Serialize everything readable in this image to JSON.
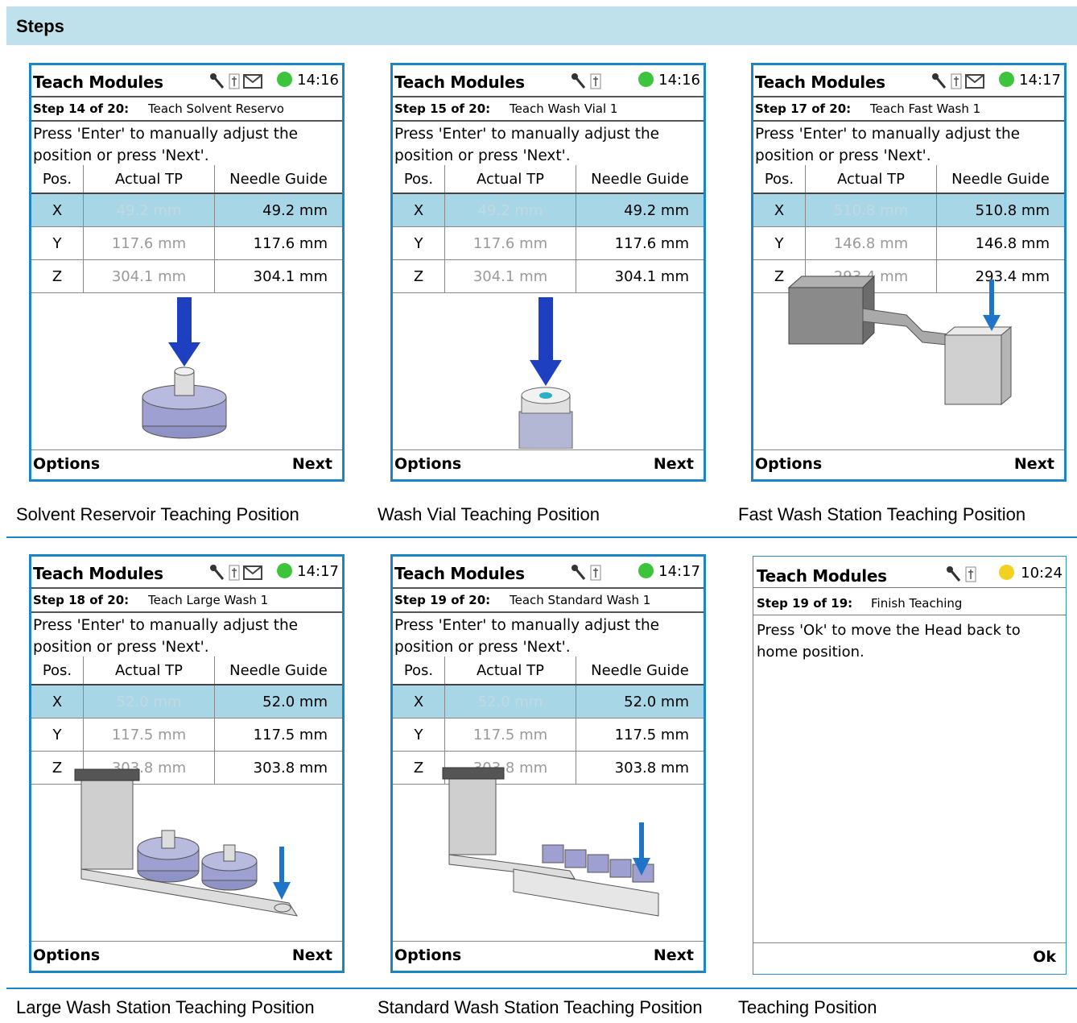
{
  "header": {
    "title": "Steps"
  },
  "panels": [
    {
      "title": "Teach Modules",
      "time": "14:16",
      "step_bold": "Step 14 of 20:",
      "step_name": "Teach Solvent Reservo",
      "instruction": "Press 'Enter' to manually adjust the position or press 'Next'.",
      "columns": [
        "Pos.",
        "Actual TP",
        "Needle Guide"
      ],
      "rows": [
        [
          "X",
          "49.2 mm",
          "49.2 mm"
        ],
        [
          "Y",
          "117.6 mm",
          "117.6 mm"
        ],
        [
          "Z",
          "304.1 mm",
          "304.1 mm"
        ]
      ],
      "left_key": "Options",
      "right_key": "Next",
      "caption": "Solvent Reservoir Teaching Position"
    },
    {
      "title": "Teach Modules",
      "time": "14:16",
      "step_bold": "Step 15 of 20:",
      "step_name": "Teach Wash Vial 1",
      "instruction": "Press 'Enter' to manually adjust the position or press 'Next'.",
      "columns": [
        "Pos.",
        "Actual TP",
        "Needle Guide"
      ],
      "rows": [
        [
          "X",
          "49.2 mm",
          "49.2 mm"
        ],
        [
          "Y",
          "117.6 mm",
          "117.6 mm"
        ],
        [
          "Z",
          "304.1 mm",
          "304.1 mm"
        ]
      ],
      "left_key": "Options",
      "right_key": "Next",
      "caption": "Wash Vial Teaching Position"
    },
    {
      "title": "Teach Modules",
      "time": "14:17",
      "step_bold": "Step 17 of 20:",
      "step_name": "Teach Fast Wash 1",
      "instruction": "Press 'Enter' to manually adjust the position or press 'Next'.",
      "columns": [
        "Pos.",
        "Actual TP",
        "Needle Guide"
      ],
      "rows": [
        [
          "X",
          "510.8 mm",
          "510.8 mm"
        ],
        [
          "Y",
          "146.8 mm",
          "146.8 mm"
        ],
        [
          "Z",
          "293.4 mm",
          "293.4 mm"
        ]
      ],
      "left_key": "Options",
      "right_key": "Next",
      "caption": "Fast Wash Station Teaching Position"
    },
    {
      "title": "Teach Modules",
      "time": "14:17",
      "step_bold": "Step 18 of 20:",
      "step_name": "Teach Large Wash 1",
      "instruction": "Press 'Enter' to manually adjust the position or press 'Next'.",
      "columns": [
        "Pos.",
        "Actual TP",
        "Needle Guide"
      ],
      "rows": [
        [
          "X",
          "52.0 mm",
          "52.0 mm"
        ],
        [
          "Y",
          "117.5 mm",
          "117.5 mm"
        ],
        [
          "Z",
          "303.8 mm",
          "303.8 mm"
        ]
      ],
      "left_key": "Options",
      "right_key": "Next",
      "caption": "Large Wash Station Teaching Position"
    },
    {
      "title": "Teach Modules",
      "time": "14:17",
      "step_bold": "Step 19 of 20:",
      "step_name": "Teach Standard Wash 1",
      "instruction": "Press 'Enter' to manually adjust the position or press 'Next'.",
      "columns": [
        "Pos.",
        "Actual TP",
        "Needle Guide"
      ],
      "rows": [
        [
          "X",
          "52.0 mm",
          "52.0 mm"
        ],
        [
          "Y",
          "117.5 mm",
          "117.5 mm"
        ],
        [
          "Z",
          "303.8 mm",
          "303.8 mm"
        ]
      ],
      "left_key": "Options",
      "right_key": "Next",
      "caption": "Standard Wash Station Teaching Position"
    },
    {
      "title": "Teach Modules",
      "time": "10:24",
      "step_bold": "Step 19 of 19:",
      "step_name": "Finish Teaching",
      "instruction": "Press 'Ok' to move the Head back to home position.",
      "right_key": "Ok",
      "caption": "Teaching Position"
    }
  ],
  "colors": {
    "accent": "#1b85c7",
    "header_bg": "#bfe1ec",
    "selected_row": "#a7d6e6",
    "status_green": "#3cc43c",
    "status_yellow": "#f2d21e",
    "arrow_dark_blue": "#1e3fbf",
    "arrow_blue": "#1f74c9"
  }
}
